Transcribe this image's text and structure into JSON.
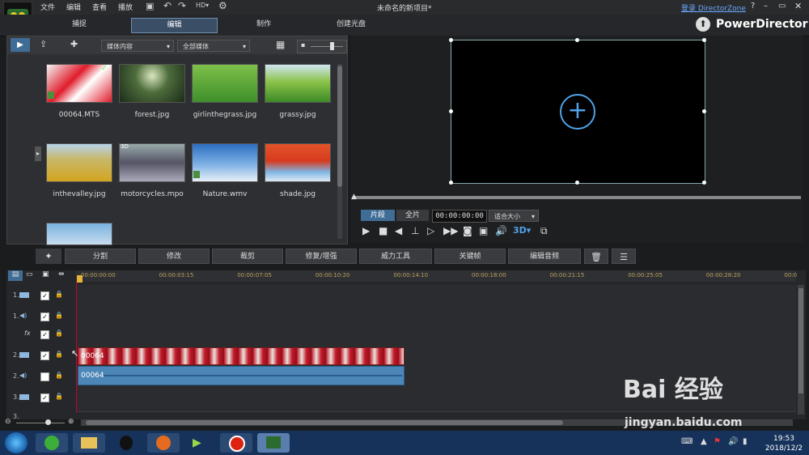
{
  "titlebar": {
    "menus": [
      "文件",
      "编辑",
      "查看",
      "播放"
    ],
    "title": "未命名的新项目*",
    "login": "登录 DirectorZone",
    "help": "?"
  },
  "modes": [
    "捕捉",
    "编辑",
    "制作",
    "创建光盘"
  ],
  "brand": "PowerDirector",
  "library": {
    "dropdown1": "媒体内容",
    "dropdown2": "全部媒体",
    "items": [
      {
        "name": "00064.MTS"
      },
      {
        "name": "forest.jpg"
      },
      {
        "name": "girlinthegrass.jpg"
      },
      {
        "name": "grassy.jpg"
      },
      {
        "name": "inthevalley.jpg"
      },
      {
        "name": "motorcycles.mpo"
      },
      {
        "name": "Nature.wmv"
      },
      {
        "name": "shade.jpg"
      }
    ],
    "badge_3d": "3D"
  },
  "preview": {
    "tab_clip": "片段",
    "tab_all": "全片",
    "timecode": "00:00:00:00",
    "fit": "适合大小"
  },
  "edit_tools": [
    "分割",
    "修改",
    "裁剪",
    "修复/增强",
    "威力工具",
    "关键帧",
    "编辑音频"
  ],
  "timeline": {
    "ticks": [
      "00:00:00:00",
      "00:00:03:15",
      "00:00:07:05",
      "00:00:10:20",
      "00:00:14:10",
      "00:00:18:00",
      "00:00:21:15",
      "00:00:25:05",
      "00:00:28:20",
      "00:0"
    ],
    "tracks": [
      {
        "num": "1.",
        "type": "video"
      },
      {
        "num": "1.",
        "type": "audio"
      },
      {
        "num": "",
        "type": "fx"
      },
      {
        "num": "2.",
        "type": "video"
      },
      {
        "num": "2.",
        "type": "audio"
      },
      {
        "num": "3.",
        "type": "video"
      },
      {
        "num": "3.",
        "type": "video"
      }
    ],
    "clip_video": "00064",
    "clip_audio": "00064"
  },
  "taskbar": {
    "time": "19:53",
    "date": "2018/12/2"
  },
  "watermark": {
    "line1": "Bai  经验",
    "line2": "jingyan.baidu.com"
  },
  "colors": {
    "accent": "#3f6d96",
    "clip_red": "#c21828",
    "clip_audio": "#4b86b6"
  }
}
